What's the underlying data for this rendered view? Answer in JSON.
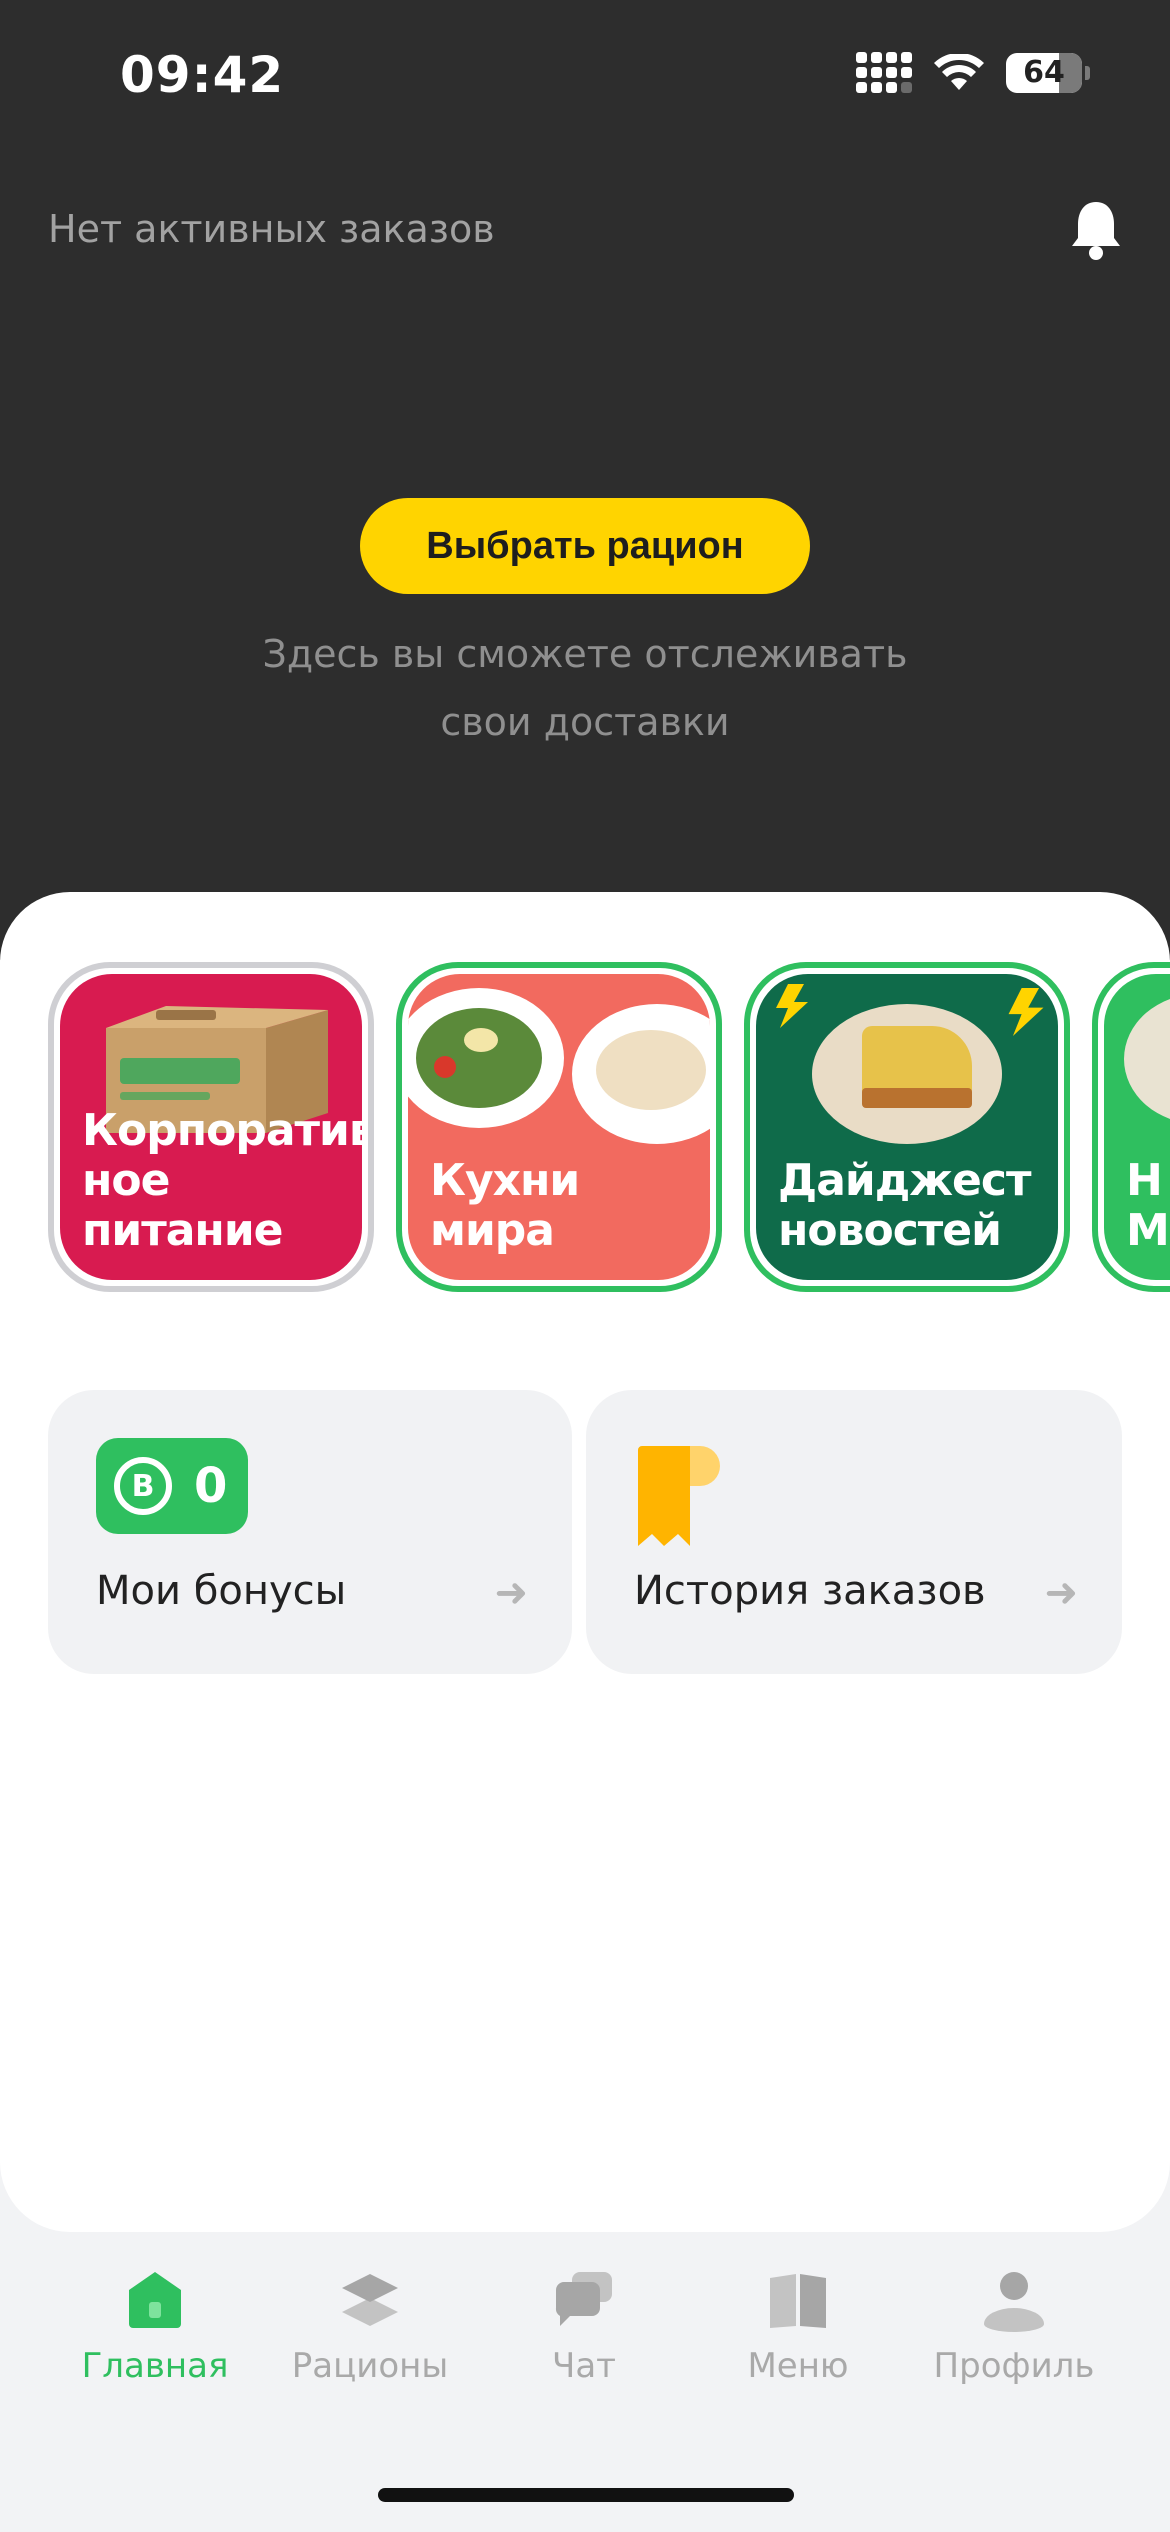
{
  "status_bar": {
    "time": "09:42",
    "battery": "64"
  },
  "header": {
    "no_orders": "Нет активных заказов",
    "choose_button": "Выбрать рацион",
    "hint_line1": "Здесь вы сможете отслеживать",
    "hint_line2": "свои доставки"
  },
  "stories": [
    {
      "line1": "Корпоратив",
      "line2": "ное питание",
      "bg": "#d81b50",
      "viewed": true
    },
    {
      "line1": "",
      "line2": "Кухни мира",
      "bg": "#f26a5f",
      "viewed": false
    },
    {
      "line1": "Дайджест",
      "line2": "новостей",
      "bg": "#0f6b4a",
      "viewed": false
    },
    {
      "line1": "Н",
      "line2": "Ме",
      "bg": "#2fbf5f",
      "viewed": false
    }
  ],
  "tiles": {
    "bonuses": {
      "label": "Мои бонусы",
      "count": "0",
      "badge_letter": "B"
    },
    "history": {
      "label": "История заказов"
    }
  },
  "tabbar": {
    "items": [
      {
        "label": "Главная",
        "icon": "home-icon",
        "active": true
      },
      {
        "label": "Рационы",
        "icon": "layers-icon",
        "active": false
      },
      {
        "label": "Чат",
        "icon": "chat-icon",
        "active": false
      },
      {
        "label": "Меню",
        "icon": "book-icon",
        "active": false
      },
      {
        "label": "Профиль",
        "icon": "profile-icon",
        "active": false
      }
    ]
  },
  "colors": {
    "accent_green": "#2fbf5f",
    "primary_yellow": "#ffd400",
    "header_bg": "#2d2d2d"
  }
}
